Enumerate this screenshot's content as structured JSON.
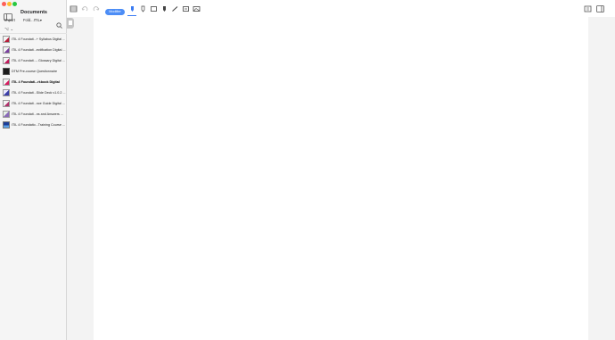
{
  "sidebar": {
    "title": "Documents",
    "import_label": "Import",
    "field_value": "Fold...ITIL",
    "sort_symbol": "⌥ ⌄",
    "documents": [
      {
        "name": "ITIL 4 Foundati...+ Syllabus Digital ..."
      },
      {
        "name": "ITIL 4 Foundati...ectification Digital ..."
      },
      {
        "name": "ITIL 4 Foundati...- Glossary Digital ..."
      },
      {
        "name": "DTM Pre-course Questionnaire"
      },
      {
        "name": "ITIL 4 Foundati...rkbook Digital"
      },
      {
        "name": "ITIL 4 Foundati...Slide Deck v1.0.2 ..."
      },
      {
        "name": "ITIL 4 Foundati...nce Guide Digital ..."
      },
      {
        "name": "ITIL 4 Foundati...ns and Answers ..."
      },
      {
        "name": "ITIL 4 Foundatio...Training Course ..."
      }
    ]
  },
  "toolbar": {
    "mode_label": "Modifier"
  },
  "colors": {
    "accent": "#4c8df6",
    "sidebar_bg": "#f5f5f5",
    "workspace_bg": "#f3f3f3"
  }
}
